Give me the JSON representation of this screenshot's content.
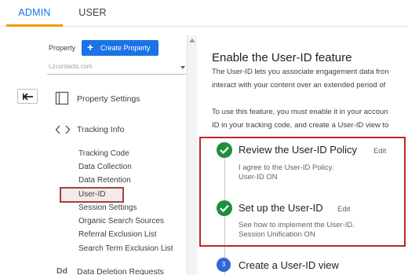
{
  "tabs": {
    "admin": "ADMIN",
    "user": "USER"
  },
  "sidebar": {
    "property_label": "Property",
    "create_property": "Create Property",
    "property_value": "Lzcontacts.com",
    "sections": {
      "property_settings": "Property Settings",
      "tracking_info": "Tracking Info",
      "data_deletion": "Data Deletion Requests",
      "data_deletion_icon": "Dd"
    },
    "items": [
      "Tracking Code",
      "Data Collection",
      "Data Retention",
      "User-ID",
      "Session Settings",
      "Organic Search Sources",
      "Referral Exclusion List",
      "Search Term Exclusion List"
    ]
  },
  "main": {
    "title": "Enable the User-ID feature",
    "para1_line1": "The User-ID lets you associate engagement data fron",
    "para1_line2": "interact with your content over an extended period of",
    "para2_line1": "To use this feature, you must enable it in your accoun",
    "para2_line2": "ID in your tracking code, and create a User-ID view to",
    "steps": [
      {
        "title": "Review the User-ID Policy",
        "edit": "Edit",
        "line1": "I agree to the User-ID Policy.",
        "line2": "User-ID ON"
      },
      {
        "title": "Set up the User-ID",
        "edit": "Edit",
        "line1": "See how to implement the User-ID.",
        "line2": "Session Unification ON"
      },
      {
        "number": "3",
        "title": "Create a User-ID view"
      }
    ]
  },
  "colors": {
    "accent": "#1a73e8",
    "tab_underline": "#f29900",
    "check": "#1e8e3e",
    "highlight_box": "#c0262a"
  }
}
